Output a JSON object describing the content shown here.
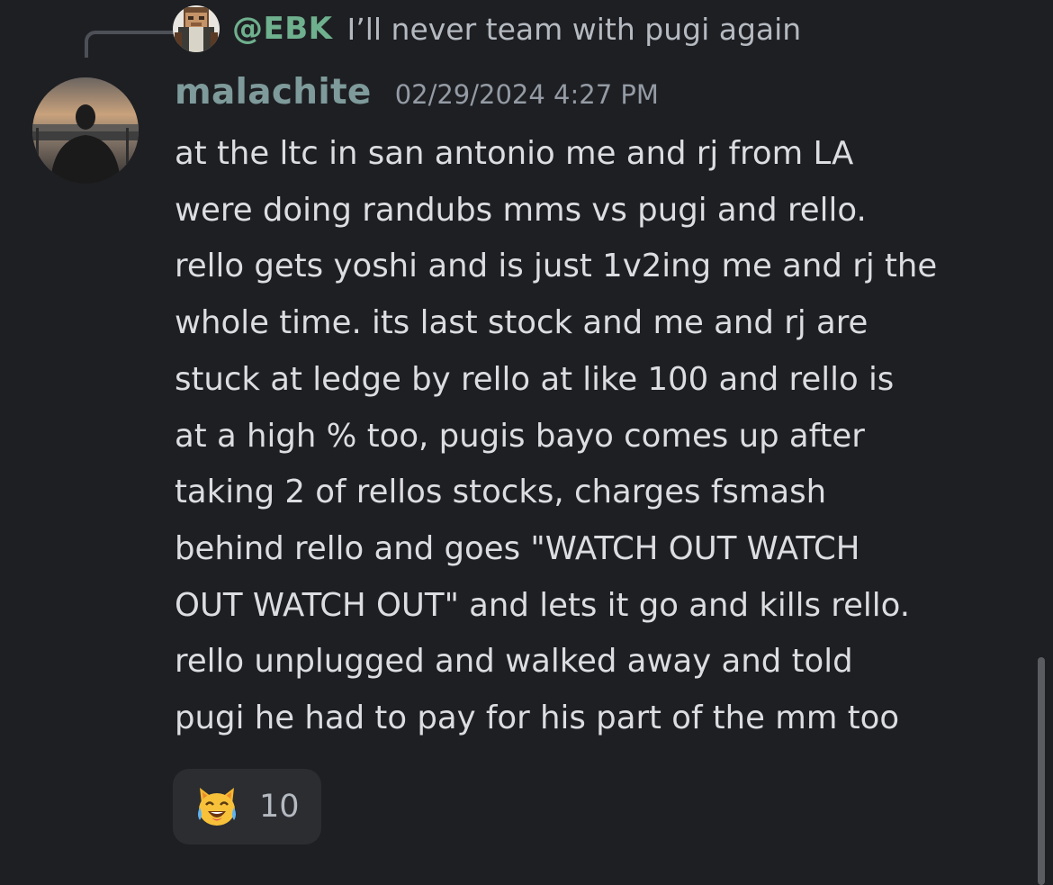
{
  "reply": {
    "author": "@EBK",
    "text": "I’ll never team with pugi again",
    "avatar_icon": "minecraft-head-avatar"
  },
  "message": {
    "username": "malachite",
    "timestamp": "02/29/2024 4:27 PM",
    "avatar_icon": "sunset-silhouette-avatar",
    "lines": [
      "at the ltc in san antonio me and rj from LA",
      "were doing randubs mms vs pugi and rello.",
      "rello gets yoshi and is just 1v2ing me and rj the",
      "whole time. its last stock and me and rj are",
      "stuck at ledge by rello at like 100 and rello is",
      "at a high % too, pugis bayo comes up after",
      "taking 2 of rellos stocks, charges fsmash",
      "behind rello and goes \"WATCH OUT WATCH",
      "OUT WATCH OUT\" and lets it go and kills rello.",
      "rello unplugged and walked away and told",
      "pugi he had to pay for his part of the mm too"
    ]
  },
  "reaction": {
    "emoji_icon": "joy-cat-icon",
    "count": "10"
  },
  "colors": {
    "background": "#1e1f23",
    "reply_author": "#6fb08e",
    "username": "#7e9a9a",
    "text": "#dcdde1",
    "muted": "#949ba4",
    "reaction_bg": "#2b2d31"
  }
}
